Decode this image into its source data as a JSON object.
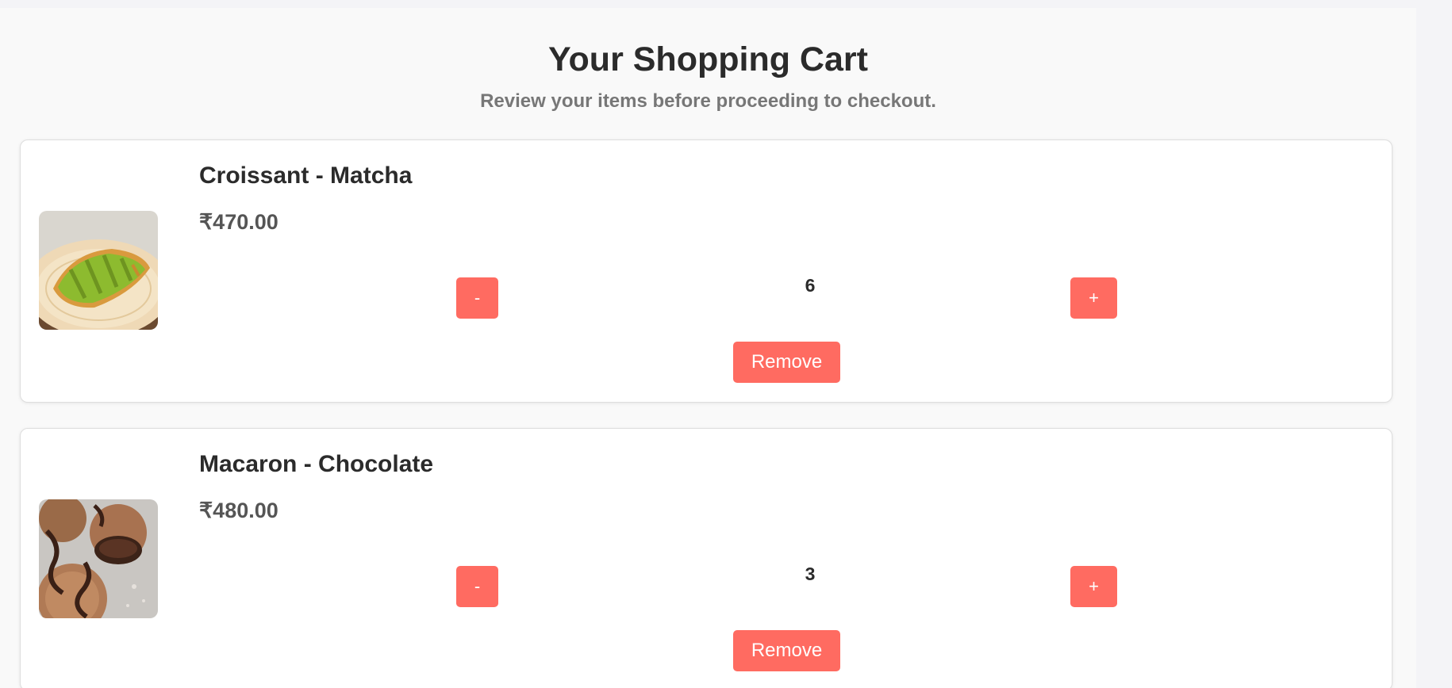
{
  "header": {
    "title": "Your Shopping Cart",
    "subtitle": "Review your items before proceeding to checkout."
  },
  "cart": {
    "items": [
      {
        "name": "Croissant - Matcha",
        "price": "₹470.00",
        "quantity": "6",
        "minus_label": "-",
        "plus_label": "+",
        "remove_label": "Remove"
      },
      {
        "name": "Macaron - Chocolate",
        "price": "₹480.00",
        "quantity": "3",
        "minus_label": "-",
        "plus_label": "+",
        "remove_label": "Remove"
      }
    ]
  },
  "colors": {
    "accent": "#ff6b61",
    "title_text": "#2b2b2b",
    "subtitle_text": "#777777",
    "card_background": "#ffffff",
    "page_background": "#f9f9f9"
  }
}
